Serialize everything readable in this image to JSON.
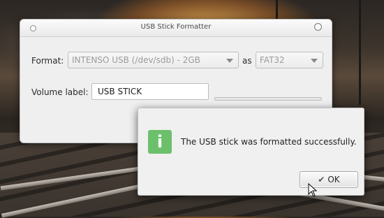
{
  "window": {
    "title": "USB Stick Formatter",
    "format_label": "Format:",
    "device": {
      "selected": "INTENSO USB (/dev/sdb) - 2GB"
    },
    "as_label": "as",
    "filesystem": {
      "selected": "FAT32"
    },
    "volume_label_label": "Volume label:",
    "volume_label_value": "USB STICK",
    "progress": 1.0
  },
  "dialog": {
    "icon": "info-icon",
    "message": "The USB stick was formatted successfully.",
    "ok_label": "OK",
    "ok_icon": "check-icon"
  },
  "colors": {
    "info_icon_bg": "#6cc06c"
  }
}
